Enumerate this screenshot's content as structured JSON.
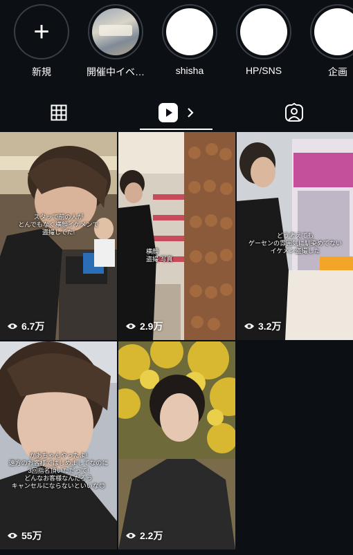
{
  "highlights": [
    {
      "label": "新規"
    },
    {
      "label": "開催中イベ…"
    },
    {
      "label": "shisha"
    },
    {
      "label": "HP/SNS"
    },
    {
      "label": "企画"
    }
  ],
  "tabs": {
    "posts_icon": "grid-icon",
    "reels_icon": "play-icon",
    "tagged_icon": "tagged-person-icon"
  },
  "reels": [
    {
      "caption": "スタッで前の人が\nとんでもなく横顔イケメンで\n盗撮してた!",
      "views": "6.7万"
    },
    {
      "caption": "横顔\n盗撮 写真",
      "views": "2.9万"
    },
    {
      "caption": "どう考えても\nゲーセンの雰囲気に馴染めてない\nイケメン盗撮した",
      "views": "3.2万"
    },
    {
      "caption": "かあちゃんやったよ!\n遠方のお客様ではじめましてなのに\n3回指名頂いただって!\nどんなお客様なんだろう\nキャンセルにならないといいな😊",
      "views": "55万"
    },
    {
      "caption": "",
      "views": "2.2万"
    }
  ],
  "colors": {
    "background": "#0c0f14",
    "text": "#ffffff",
    "ring": "#3a3f47"
  }
}
